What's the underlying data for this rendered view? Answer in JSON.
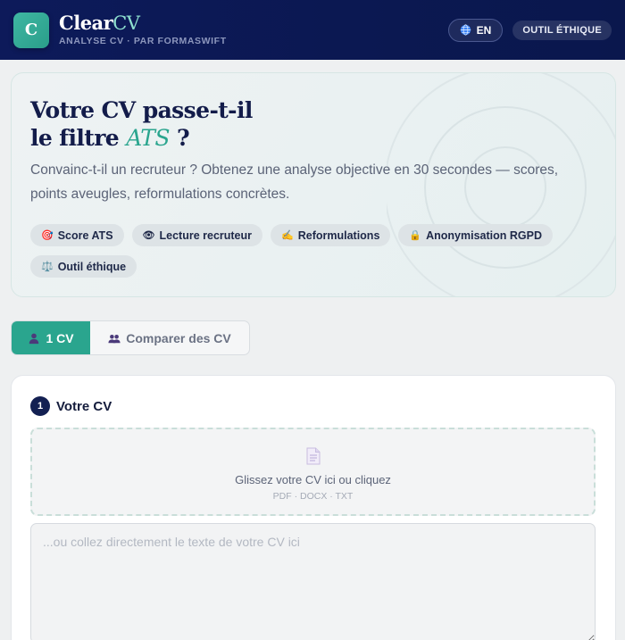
{
  "header": {
    "logo_letter": "C",
    "brand_main": "Clear",
    "brand_accent": "CV",
    "subtitle": "ANALYSE CV · PAR FORMASWIFT",
    "language_label": "EN",
    "ethics_label": "OUTIL ÉTHIQUE"
  },
  "hero": {
    "title_line1": "Votre CV passe-t-il",
    "title_line2_prefix": "le filtre ",
    "title_line2_accent": "ATS",
    "title_line2_suffix": " ?",
    "description": "Convainc-t-il un recruteur ? Obtenez une analyse objective en 30 secondes — scores, points aveugles, reformulations concrètes.",
    "chips": [
      {
        "icon": "🎯",
        "label": "Score ATS"
      },
      {
        "icon": "👁",
        "label": "Lecture recruteur"
      },
      {
        "icon": "✍️",
        "label": "Reformulations"
      },
      {
        "icon": "🔒",
        "label": "Anonymisation RGPD"
      },
      {
        "icon": "⚖️",
        "label": "Outil éthique"
      }
    ]
  },
  "tabs": {
    "single_label": "1 CV",
    "compare_label": "Comparer des CV"
  },
  "upload": {
    "step_number": "1",
    "step_title": "Votre CV",
    "drop_text": "Glissez votre CV ici ou cliquez",
    "formats": "PDF · DOCX · TXT",
    "textarea_placeholder": "...ou collez directement le texte de votre CV ici"
  },
  "colors": {
    "header_bg": "#0d1a5a",
    "accent": "#2aa58e",
    "step_badge": "#132052"
  }
}
